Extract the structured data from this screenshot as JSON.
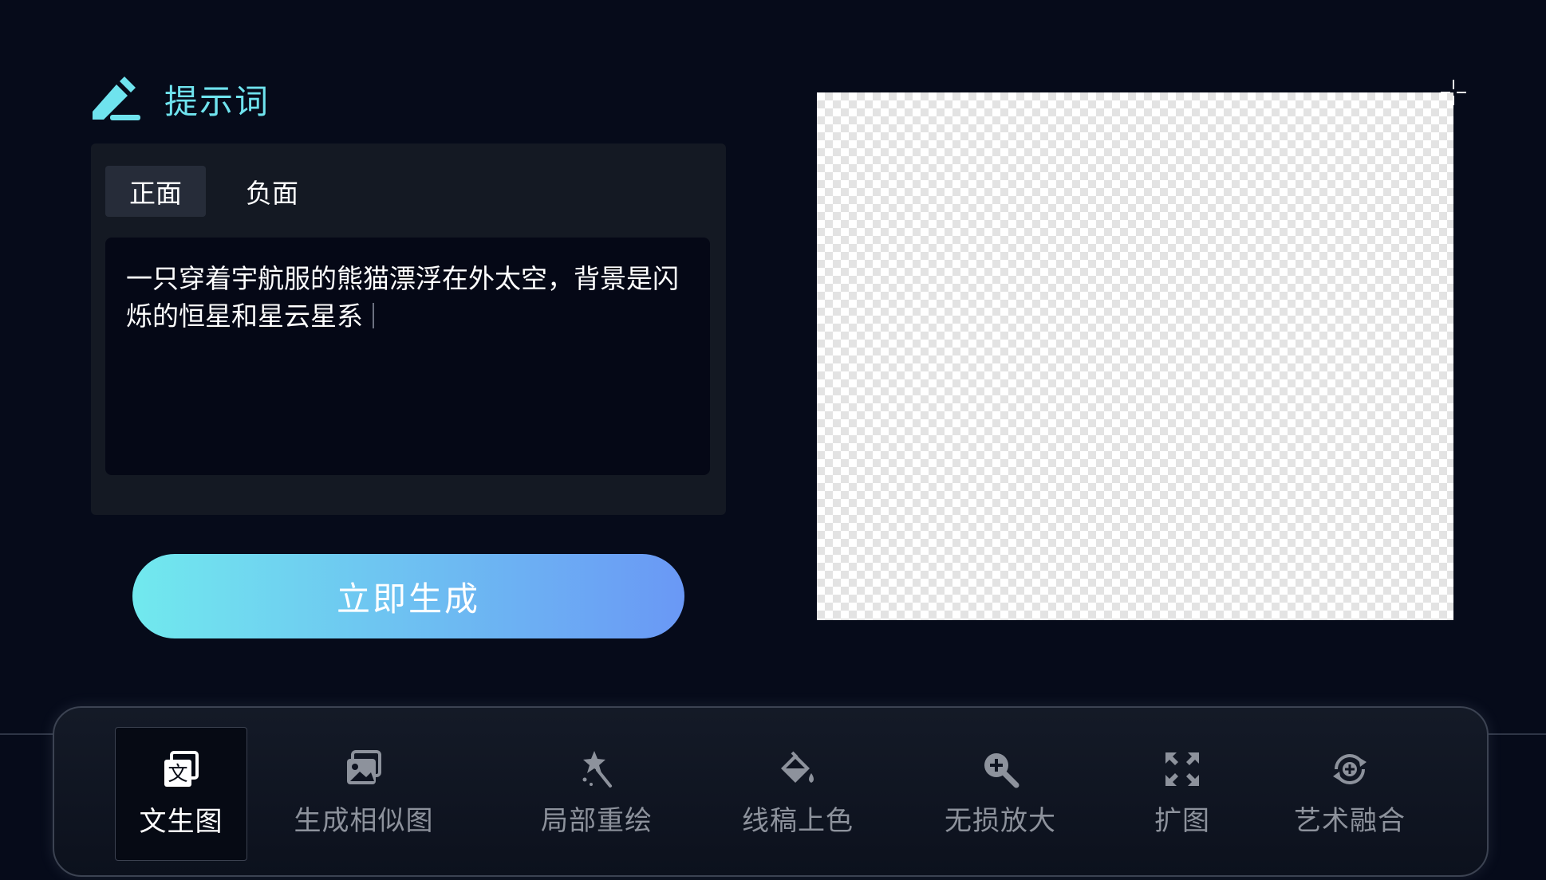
{
  "prompt": {
    "title": "提示词",
    "icon": "pencil-icon",
    "tabs": [
      {
        "label": "正面",
        "active": true
      },
      {
        "label": "负面",
        "active": false
      }
    ],
    "text": "一只穿着宇航服的熊猫漂浮在外太空，背景是闪烁的恒星和星云星系"
  },
  "generate_button": {
    "label": "立即生成"
  },
  "canvas": {
    "icon": "crosshair-icon"
  },
  "toolbar": {
    "items": [
      {
        "label": "文生图",
        "icon": "text-to-image-icon",
        "active": true
      },
      {
        "label": "生成相似图",
        "icon": "similar-image-icon",
        "active": false
      },
      {
        "label": "局部重绘",
        "icon": "magic-wand-icon",
        "active": false
      },
      {
        "label": "线稿上色",
        "icon": "paint-bucket-icon",
        "active": false
      },
      {
        "label": "无损放大",
        "icon": "zoom-in-icon",
        "active": false
      },
      {
        "label": "扩图",
        "icon": "expand-icon",
        "active": false
      },
      {
        "label": "艺术融合",
        "icon": "art-fusion-icon",
        "active": false
      }
    ]
  },
  "colors": {
    "background": "#060b1a",
    "accent": "#6fe3ee",
    "button_gradient_start": "#71e9ee",
    "button_gradient_end": "#6a98f5"
  }
}
